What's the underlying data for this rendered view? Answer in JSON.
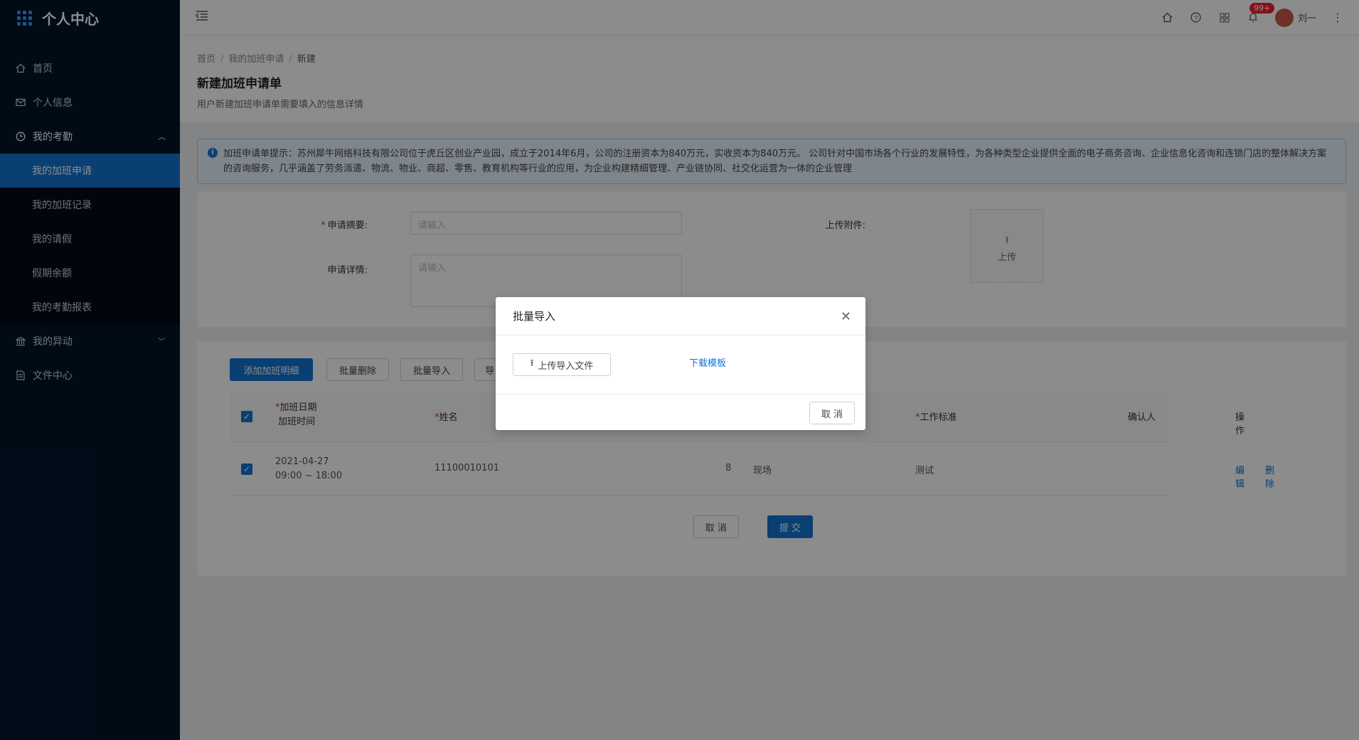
{
  "app": {
    "title": "个人中心"
  },
  "sidebar": {
    "items": [
      {
        "label": "首页",
        "icon": "home-icon"
      },
      {
        "label": "个人信息",
        "icon": "mail-icon"
      },
      {
        "label": "我的考勤",
        "icon": "clock-icon"
      },
      {
        "label": "我的异动",
        "icon": "bank-icon"
      },
      {
        "label": "文件中心",
        "icon": "file-icon"
      }
    ],
    "attendance_sub": [
      {
        "label": "我的加班申请"
      },
      {
        "label": "我的加班记录"
      },
      {
        "label": "我的请假"
      },
      {
        "label": "假期余额"
      },
      {
        "label": "我的考勤报表"
      }
    ]
  },
  "header": {
    "notification_count": "99+",
    "user_name": "刘一"
  },
  "breadcrumb": [
    "首页",
    "我的加班申请",
    "新建"
  ],
  "page": {
    "title": "新建加班申请单",
    "description": "用户新建加班申请单需要填入的信息详情"
  },
  "alert": {
    "text": "加班申请单提示：苏州犀牛网络科技有限公司位于虎丘区创业产业园，成立于2014年6月，公司的注册资本为840万元，实收资本为840万元。 公司针对中国市场各个行业的发展特性，为各种类型企业提供全面的电子商务咨询、企业信息化咨询和连锁门店的整体解决方案的咨询服务，几乎涵盖了劳务派遣、物流、物业、商超、零售、教育机构等行业的应用，为企业构建精细管理、产业链协同、社交化运营为一体的企业管理"
  },
  "form": {
    "summary_label": "申请摘要:",
    "summary_placeholder": "请输入",
    "detail_label": "申请详情:",
    "detail_placeholder": "请输入",
    "attachment_label": "上传附件:",
    "upload_label": "上传"
  },
  "toolbar": {
    "add_label": "添加加班明细",
    "batch_delete_label": "批量删除",
    "batch_import_label": "批量导入",
    "export_label": "导"
  },
  "table": {
    "headers": {
      "date": "加班日期",
      "time": "加班时间",
      "name": "姓名",
      "work_standard": "工作标准",
      "confirmer": "确认人",
      "actions": "操作"
    },
    "rows": [
      {
        "date": "2021-04-27",
        "time": "09:00 ~ 18:00",
        "name": "11100010101",
        "hours": "8",
        "location": "现场",
        "work_standard": "测试",
        "confirmer": "",
        "edit_label": "编辑",
        "delete_label": "删除"
      }
    ]
  },
  "footer": {
    "cancel_label": "取 消",
    "submit_label": "提 交"
  },
  "modal": {
    "title": "批量导入",
    "upload_label": "上传导入文件",
    "download_label": "下载模板",
    "cancel_label": "取 消"
  },
  "colors": {
    "primary": "#1173d1",
    "sidebar_bg": "#001529",
    "danger": "#f5222d"
  }
}
